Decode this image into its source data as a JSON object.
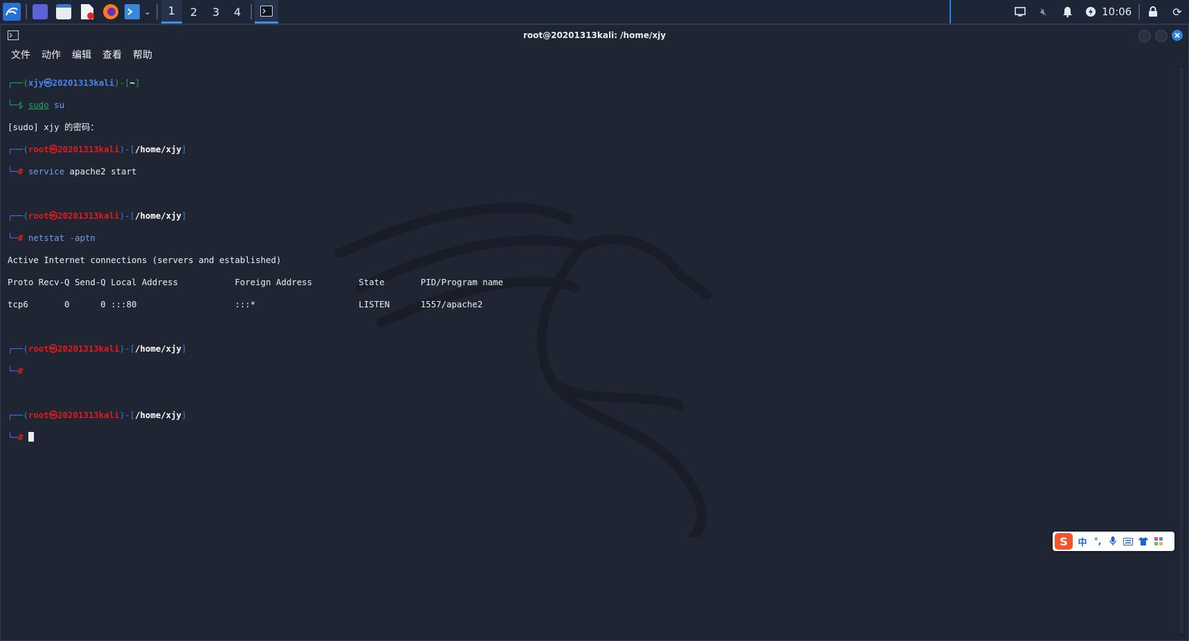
{
  "taskbar": {
    "workspaces": [
      "1",
      "2",
      "3",
      "4"
    ],
    "active_workspace": "1",
    "clock": "10:06",
    "icons": [
      "kali-menu-icon",
      "desktop-icon",
      "file-manager-icon",
      "text-editor-icon",
      "firefox-icon",
      "terminal-icon",
      "chevron-down-icon",
      "terminal-task-icon",
      "display-icon",
      "volume-muted-icon",
      "notification-bell-icon",
      "power-manager-icon",
      "lock-icon",
      "logout-icon"
    ]
  },
  "window": {
    "title": "root@20201313kali: /home/xjy",
    "menu": [
      "文件",
      "动作",
      "编辑",
      "查看",
      "帮助"
    ]
  },
  "terminal": {
    "l1_user": "xjy",
    "l1_at": "㉿",
    "l1_host": "20201313kali",
    "l1_dir": "~",
    "l2_cmd": "sudo",
    "l2_arg": "su",
    "l3": "[sudo] xjy 的密码：",
    "root_user": "root",
    "root_at": "㉿",
    "root_host": "20201313kali",
    "root_dir": "/home/xjy",
    "cmd1": "service",
    "cmd1_args": "apache2 start",
    "cmd2": "netstat",
    "cmd2_args": "-aptn",
    "out1": "Active Internet connections (servers and established)",
    "out2": "Proto Recv-Q Send-Q Local Address           Foreign Address         State       PID/Program name",
    "out3": "tcp6       0      0 :::80                   :::*                    LISTEN      1557/apache2"
  },
  "ime": {
    "logo": "S",
    "mode": "中",
    "punct": "°,"
  },
  "colors": {
    "background": "#1c2230",
    "prompt_blue": "#3a7be0",
    "root_red": "#e01b1b",
    "close_button": "#2d7fe0"
  }
}
